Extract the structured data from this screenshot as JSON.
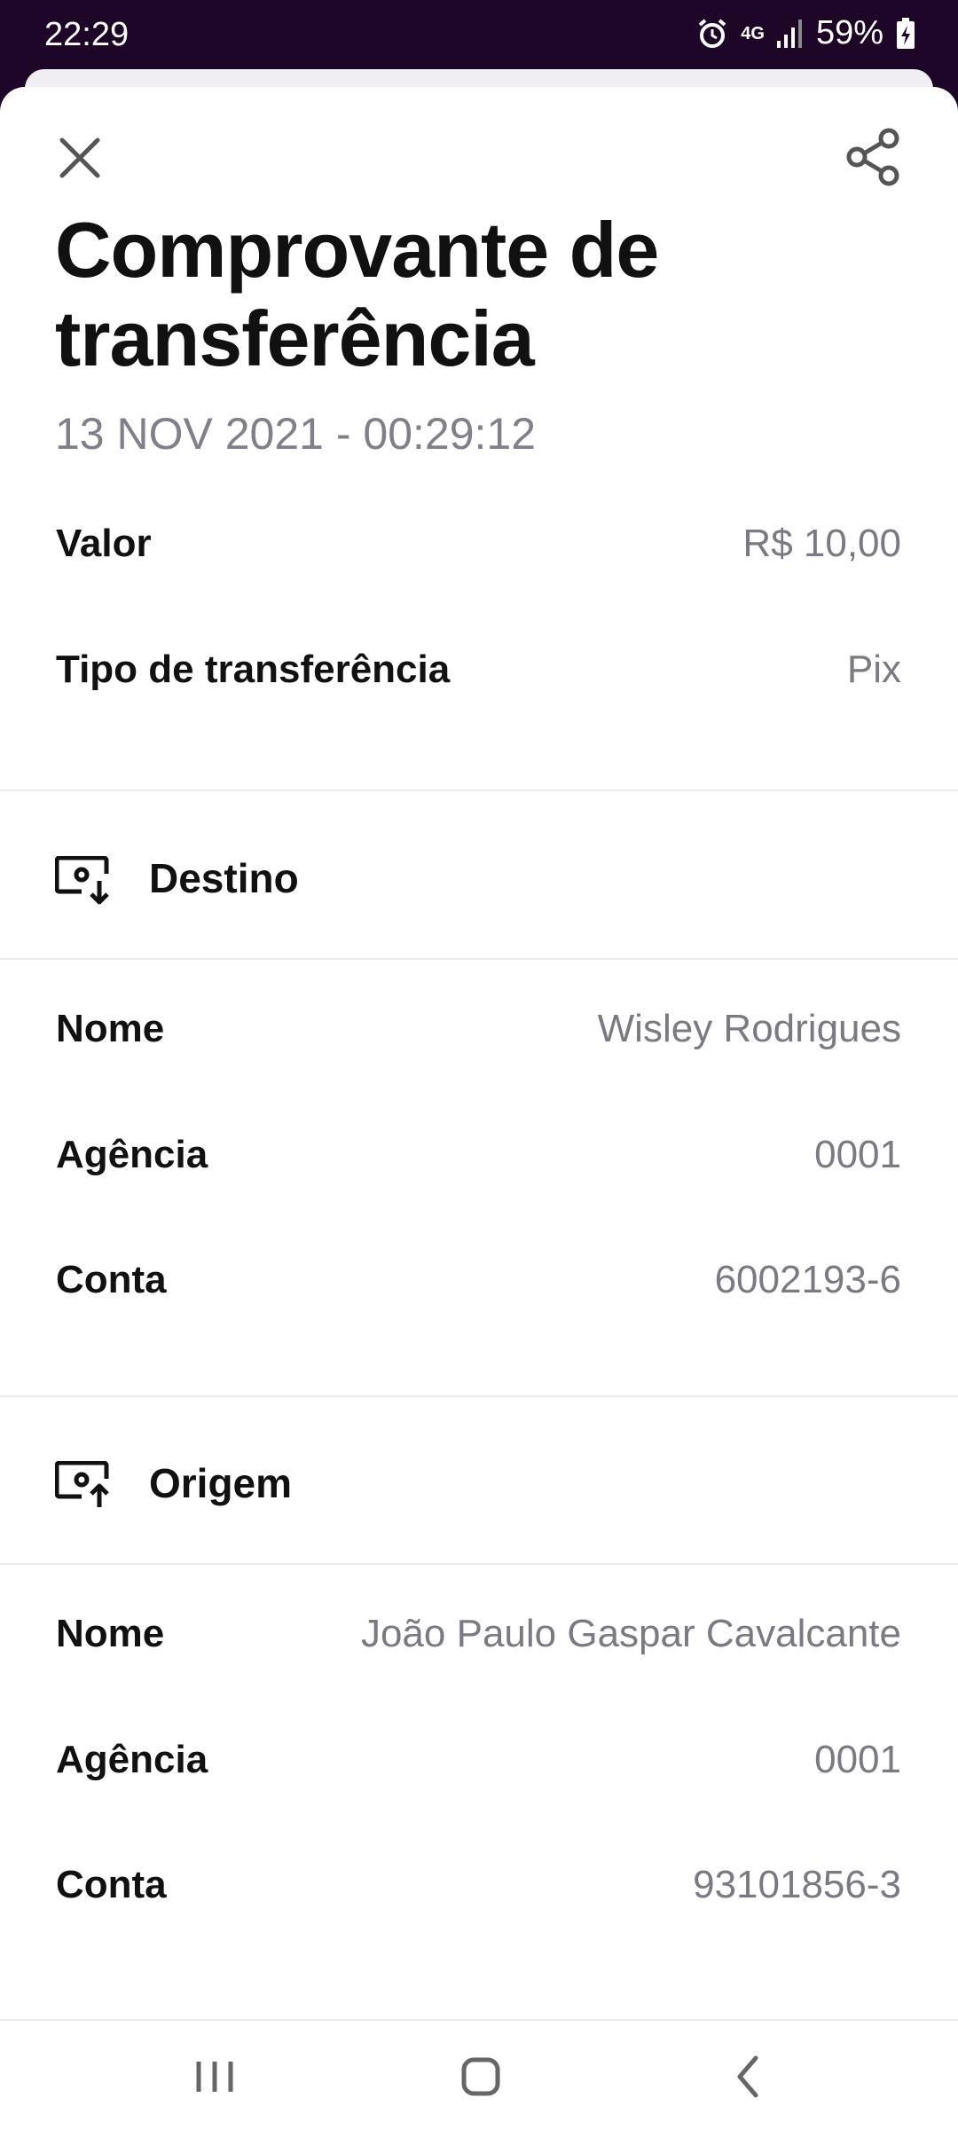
{
  "status_bar": {
    "time": "22:29",
    "battery": "59%",
    "network": "4G",
    "icons": [
      "alarm-icon",
      "network-4g-icon",
      "signal-icon",
      "battery-charging-icon"
    ]
  },
  "header": {
    "close_icon": "close-icon",
    "share_icon": "share-icon",
    "title": "Comprovante de transferência",
    "date": "13 NOV 2021 - 00:29:12"
  },
  "summary": {
    "value_label": "Valor",
    "value": "R$ 10,00",
    "type_label": "Tipo de transferência",
    "type": "Pix"
  },
  "destination": {
    "title": "Destino",
    "icon": "money-receive-icon",
    "name_label": "Nome",
    "name": "Wisley Rodrigues",
    "agency_label": "Agência",
    "agency": "0001",
    "account_label": "Conta",
    "account": "6002193-6"
  },
  "origin": {
    "title": "Origem",
    "icon": "money-send-icon",
    "name_label": "Nome",
    "name": "João Paulo Gaspar Cavalcante",
    "agency_label": "Agência",
    "agency": "0001",
    "account_label": "Conta",
    "account": "93101856-3"
  },
  "nav_bar": {
    "icons": [
      "recent-apps-icon",
      "home-icon",
      "back-icon"
    ]
  },
  "colors": {
    "status_bar_bg": "#1e0628",
    "label_text": "#111111",
    "value_text": "#7a7a82",
    "divider": "#ebebed"
  }
}
